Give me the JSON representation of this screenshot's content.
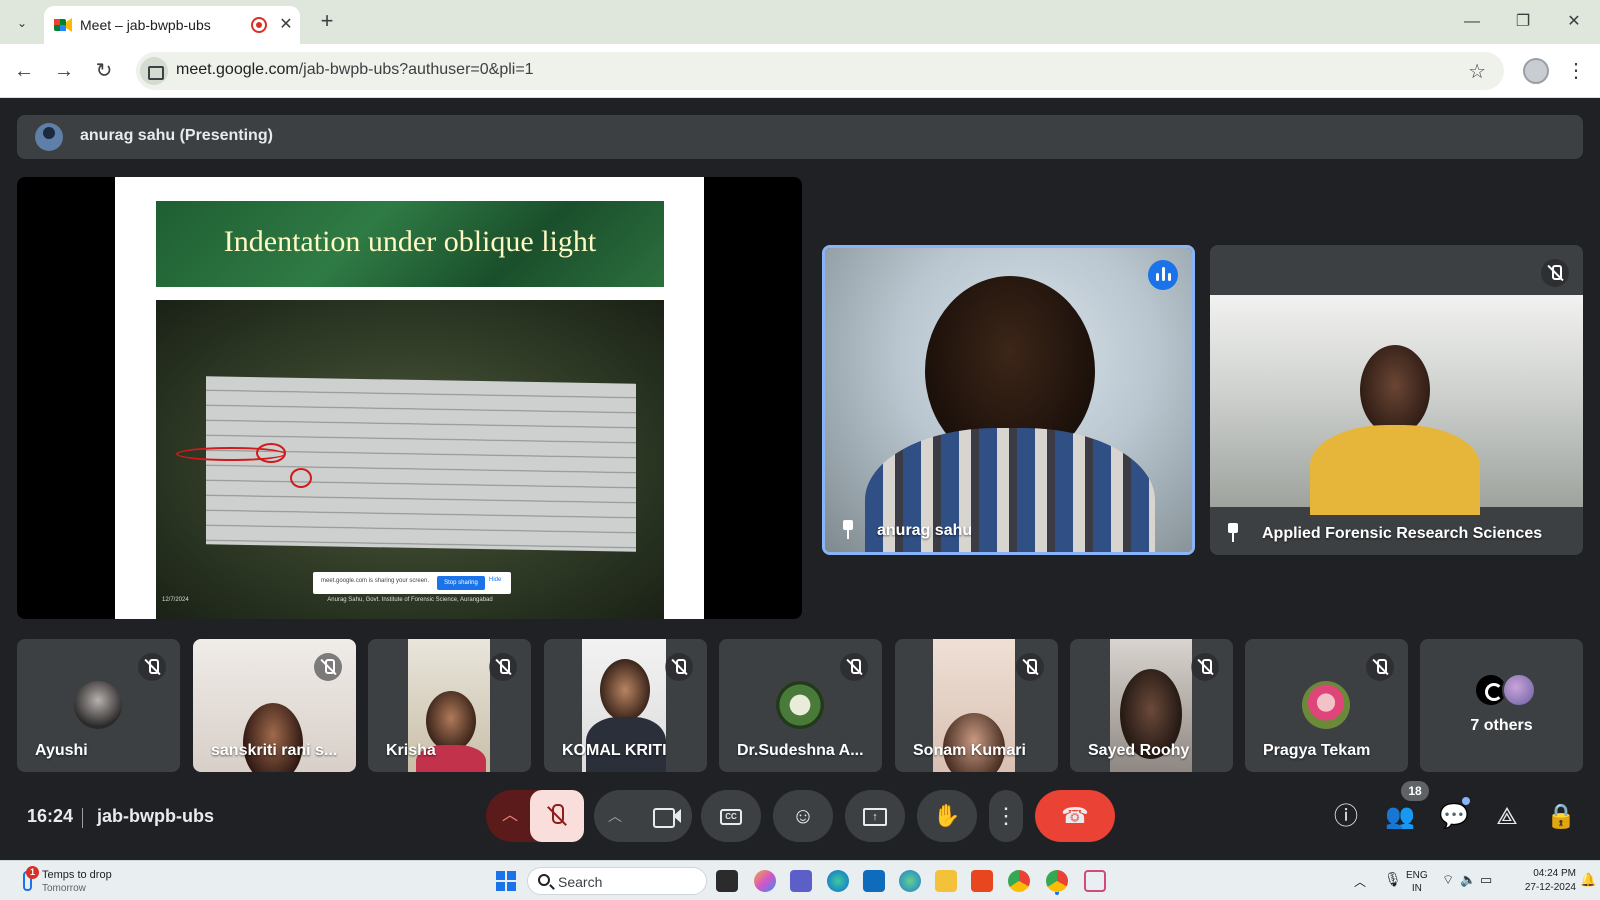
{
  "browser": {
    "tab_title": "Meet – jab-bwpb-ubs",
    "url_host": "meet.google.com",
    "url_path": "/jab-bwpb-ubs?authuser=0&pli=1"
  },
  "meet": {
    "presenting_label": "anurag sahu (Presenting)",
    "slide": {
      "title": "Indentation under oblique light",
      "share_banner_text": "meet.google.com is sharing your screen.",
      "share_banner_stop": "Stop sharing",
      "share_banner_hide": "Hide",
      "footer": "Anurag Sahu, Govt. Institute of Forensic Science, Aurangabad",
      "date": "12/7/2024"
    },
    "main_tiles": [
      {
        "name": "anurag sahu",
        "speaking": true
      },
      {
        "name": "Applied Forensic Research Sciences",
        "speaking": false
      }
    ],
    "participants": [
      {
        "name": "Ayushi"
      },
      {
        "name": "sanskriti rani s..."
      },
      {
        "name": "Krisha"
      },
      {
        "name": "KOMAL KRITI"
      },
      {
        "name": "Dr.Sudeshna A..."
      },
      {
        "name": "Sonam Kumari"
      },
      {
        "name": "Sayed Roohy"
      },
      {
        "name": "Pragya Tekam"
      }
    ],
    "others_label": "7 others",
    "time": "16:24",
    "meeting_code": "jab-bwpb-ubs",
    "people_count": "18",
    "colors": {
      "accent": "#8ab4f8",
      "end_call": "#ea4335",
      "mic_off_bg": "#f9dedc",
      "background": "#202124"
    }
  },
  "taskbar": {
    "weather_badge": "1",
    "weather_line1": "Temps to drop",
    "weather_line2": "Tomorrow",
    "search_placeholder": "Search",
    "lang_line1": "ENG",
    "lang_line2": "IN",
    "time": "04:24 PM",
    "date": "27-12-2024"
  }
}
